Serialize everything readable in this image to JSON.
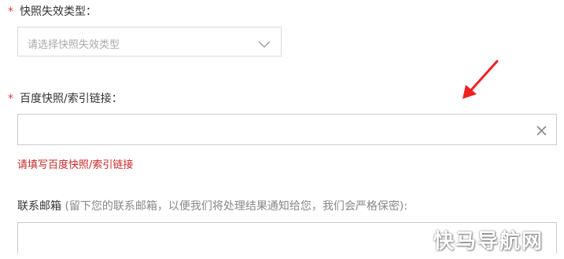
{
  "form": {
    "expire_type": {
      "required_mark": "*",
      "label": "快照失效类型：",
      "placeholder": "请选择快照失效类型",
      "chevron_icon": "chevron-down-icon"
    },
    "link": {
      "required_mark": "*",
      "label": "百度快照/索引链接：",
      "value": "",
      "clear_icon": "close-icon",
      "error": "请填写百度快照/索引链接"
    },
    "contact_email": {
      "label": "联系邮箱",
      "hint": "(留下您的联系邮箱，以便我们将处理结果通知给您，我们会严格保密):",
      "value": ""
    }
  },
  "annotation": {
    "arrow_icon": "red-arrow-icon",
    "color": "#ee2222"
  },
  "watermark": {
    "text": "快马导航网"
  },
  "colors": {
    "required": "#e53935",
    "error": "#c62828",
    "border": "#cccccc"
  }
}
